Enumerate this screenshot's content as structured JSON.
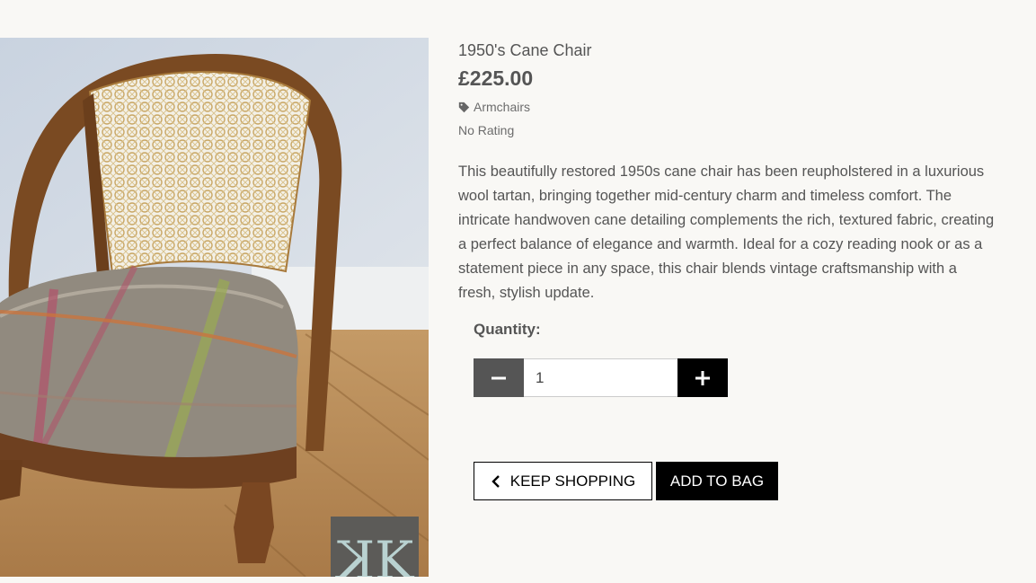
{
  "product": {
    "title": "1950's Cane Chair",
    "price": "£225.00",
    "category": "Armchairs",
    "category_icon": "tag-icon",
    "rating": "No Rating",
    "description": "This beautifully restored 1950s cane chair has been reupholstered in a luxurious wool tartan, bringing together mid-century charm and timeless comfort. The intricate handwoven cane detailing complements the rich, textured fabric, creating a perfect balance of elegance and warmth. Ideal for a cozy reading nook or as a statement piece in any space, this chair blends vintage craftsmanship with a fresh, stylish update.",
    "watermark_text": "KK"
  },
  "quantity": {
    "label": "Quantity:",
    "value": "1",
    "decrement_icon": "minus-icon",
    "increment_icon": "plus-icon"
  },
  "actions": {
    "keep_shopping": "KEEP SHOPPING",
    "keep_shopping_icon": "chevron-left-icon",
    "add_to_bag": "ADD TO BAG"
  },
  "colors": {
    "background": "#f9f8f5",
    "primary_button": "#000000",
    "decrement_button": "#555555",
    "text": "#555555"
  }
}
